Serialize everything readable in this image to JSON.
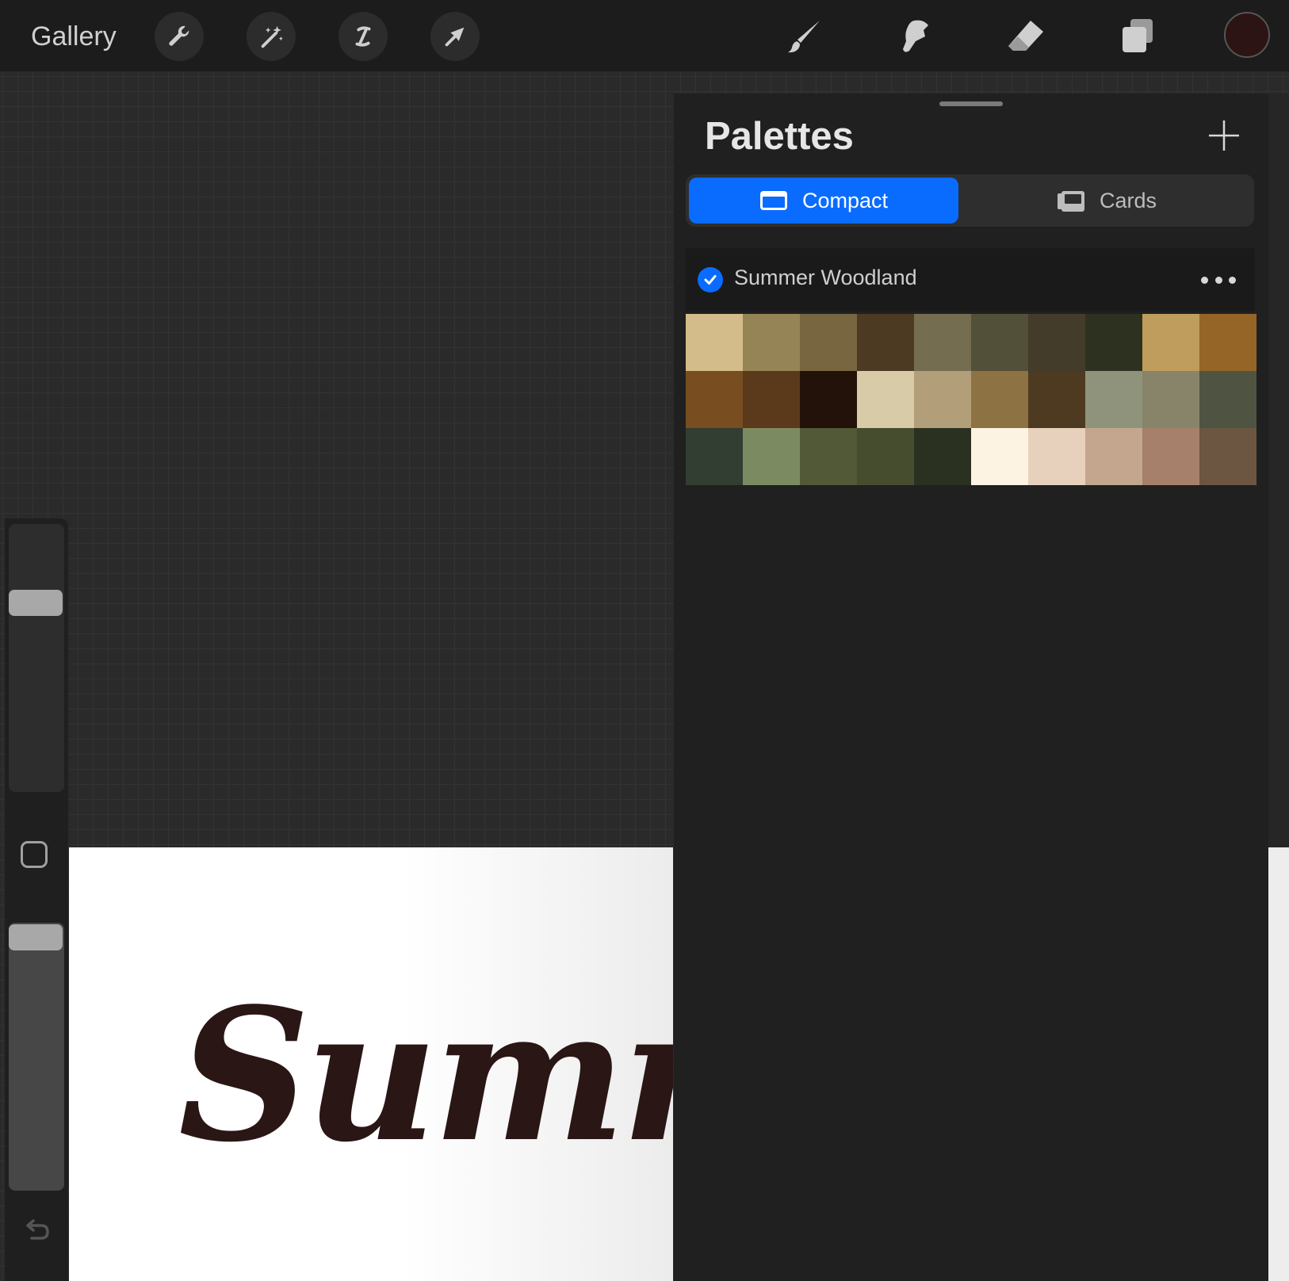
{
  "toolbar": {
    "gallery_label": "Gallery",
    "left_tools": [
      "wrench-icon",
      "magic-wand-icon",
      "selection-icon",
      "transform-arrow-icon"
    ],
    "right_tools": [
      "brush-icon",
      "smudge-icon",
      "eraser-icon",
      "layers-icon"
    ],
    "current_color": "#2b1413"
  },
  "sidebar": {
    "brush_size": 0.75,
    "brush_opacity": 1.0
  },
  "canvas": {
    "lettering": "Summer"
  },
  "palettes_panel": {
    "title": "Palettes",
    "view_modes": {
      "compact_label": "Compact",
      "cards_label": "Cards",
      "selected": "Compact"
    },
    "palette": {
      "name": "Summer Woodland",
      "is_default": true,
      "swatches": [
        "#d4bc8a",
        "#958455",
        "#776640",
        "#4c3a23",
        "#756d4f",
        "#535039",
        "#443c2a",
        "#2d3120",
        "#bf9d5c",
        "#956528",
        "#784d20",
        "#5b3a1b",
        "#221209",
        "#d8cba7",
        "#b29f7a",
        "#8d7244",
        "#4e3a20",
        "#8f937b",
        "#878469",
        "#4f5442",
        "#313e31",
        "#7c8a61",
        "#525937",
        "#464d2e",
        "#2a3121",
        "#fdf3e3",
        "#e8d1bc",
        "#c4a58d",
        "#a6806a",
        "#6c5541"
      ]
    }
  }
}
